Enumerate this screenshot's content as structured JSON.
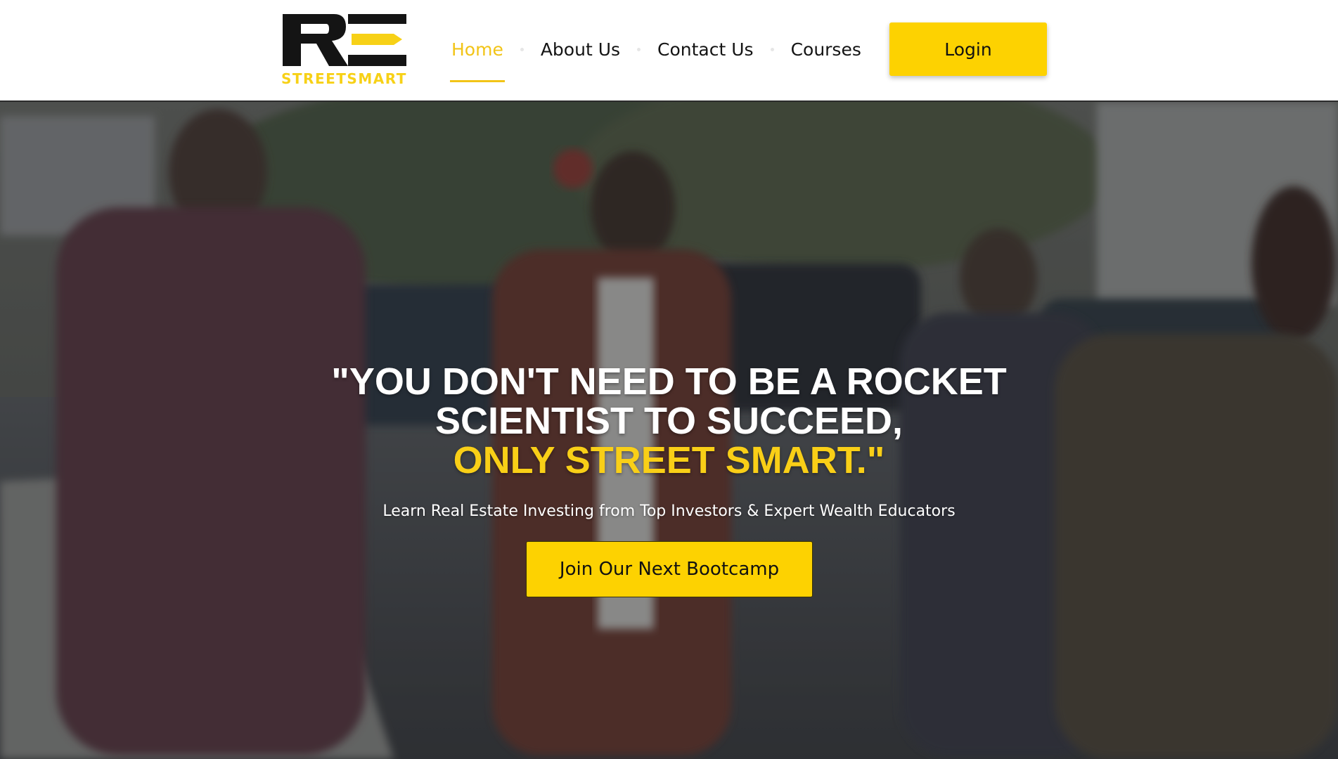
{
  "brand": {
    "logo_mark": "RE",
    "logo_text": "STREETSMART",
    "accent_color": "#fdd201",
    "dark_color": "#141414"
  },
  "nav": {
    "items": [
      {
        "label": "Home",
        "active": true
      },
      {
        "label": "About Us",
        "active": false
      },
      {
        "label": "Contact Us",
        "active": false
      },
      {
        "label": "Courses",
        "active": false
      }
    ],
    "login_label": "Login"
  },
  "hero": {
    "heading_line1": "\"YOU DON'T NEED TO BE A ROCKET",
    "heading_line2": "SCIENTIST TO SUCCEED,",
    "heading_line3": "ONLY STREET SMART.\"",
    "subheading": "Learn Real Estate Investing from Top Investors & Expert Wealth Educators",
    "cta_label": "Join Our Next Bootcamp"
  }
}
